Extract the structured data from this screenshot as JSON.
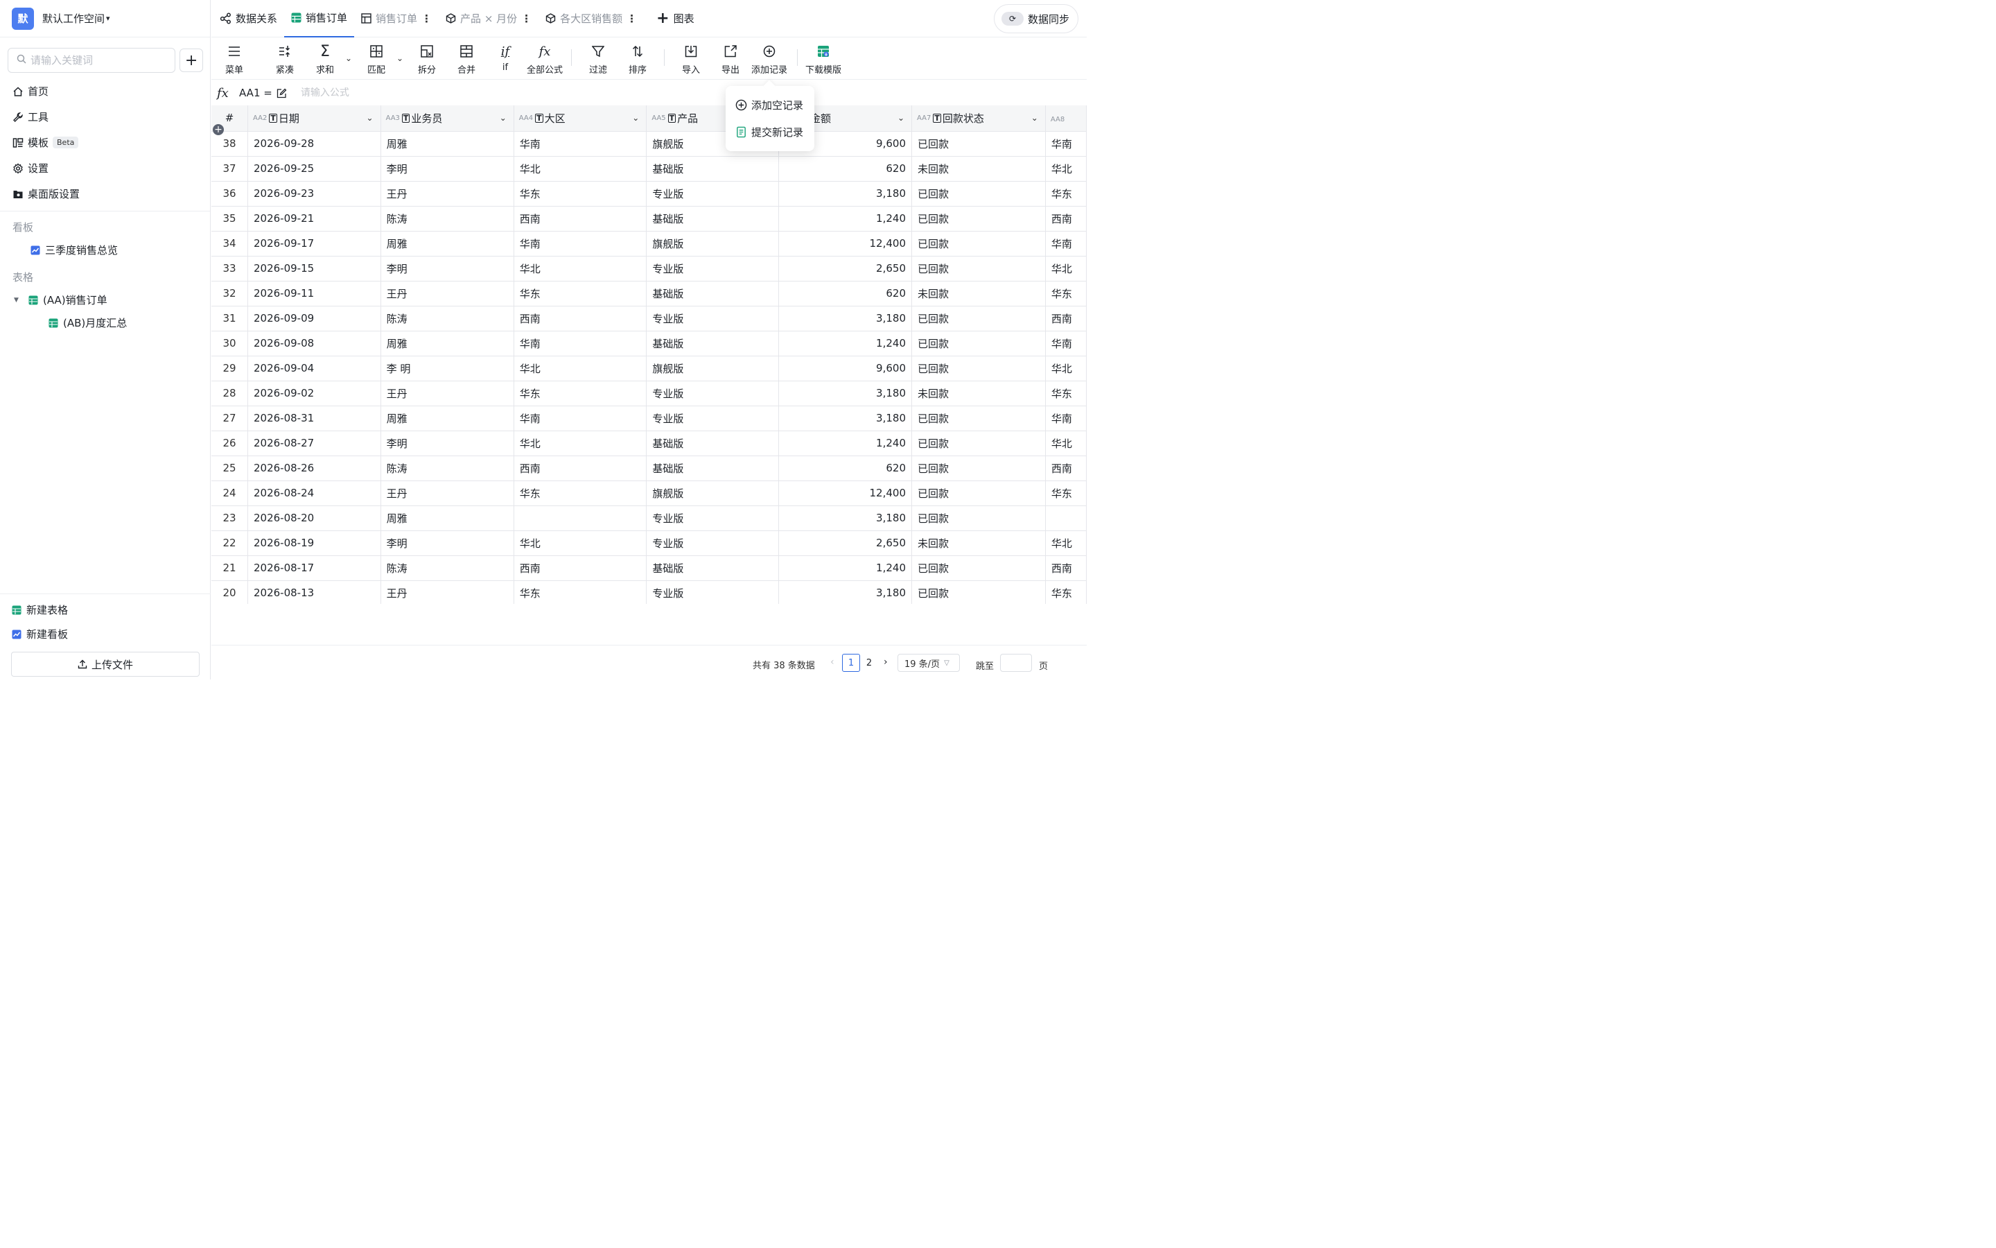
{
  "workspace": {
    "logo_char": "默",
    "name": "默认工作空间"
  },
  "sidebar": {
    "search_placeholder": "请输入关键词",
    "nav": [
      {
        "label": "首页",
        "icon": "home-icon"
      },
      {
        "label": "工具",
        "icon": "wrench-icon"
      },
      {
        "label": "模板",
        "icon": "template-icon",
        "badge": "Beta"
      },
      {
        "label": "设置",
        "icon": "gear-icon"
      },
      {
        "label": "桌面版设置",
        "icon": "desktop-settings-icon"
      }
    ],
    "section_dashboards": "看板",
    "dashboards": [
      {
        "label": "三季度销售总览"
      }
    ],
    "section_tables": "表格",
    "tables": [
      {
        "label": "(AA)销售订单"
      },
      {
        "label": "(AB)月度汇总"
      }
    ],
    "bottom": {
      "new_table": "新建表格",
      "new_dashboard": "新建看板",
      "upload": "上传文件"
    }
  },
  "tabs": [
    {
      "label": "数据关系",
      "icon": "relation-icon"
    },
    {
      "label": "销售订单",
      "icon": "table-icon",
      "active": true
    },
    {
      "label": "销售订单",
      "icon": "grid-icon"
    },
    {
      "label": "产品 × 月份",
      "icon": "cube-icon"
    },
    {
      "label": "各大区销售额",
      "icon": "cube-icon"
    },
    {
      "label": "图表",
      "icon": "plus-icon"
    }
  ],
  "sync_label": "数据同步",
  "toolbar": {
    "menu": "菜单",
    "compact": "紧凑",
    "sum": "求和",
    "match": "匹配",
    "split": "拆分",
    "merge": "合并",
    "if": "if",
    "all_formulas": "全部公式",
    "filter": "过滤",
    "sort": "排序",
    "import": "导入",
    "export": "导出",
    "add_record": "添加记录",
    "download_template": "下载模版"
  },
  "formula_bar": {
    "cell_ref": "AA1 =",
    "placeholder": "请输入公式"
  },
  "add_menu": {
    "add_empty": "添加空记录",
    "submit_new": "提交新记录"
  },
  "table": {
    "columns": [
      {
        "code": "",
        "name": "#"
      },
      {
        "code": "AA2",
        "name": "日期",
        "type": "T"
      },
      {
        "code": "AA3",
        "name": "业务员",
        "type": "T"
      },
      {
        "code": "AA4",
        "name": "大区",
        "type": "T"
      },
      {
        "code": "AA5",
        "name": "产品",
        "type": "T"
      },
      {
        "code": "",
        "name": "#金额"
      },
      {
        "code": "AA7",
        "name": "回款状态",
        "type": "T"
      },
      {
        "code": "AA8",
        "name": ""
      }
    ],
    "rows": [
      [
        "38",
        "2026-09-28",
        "周雅",
        "华南",
        "旗舰版",
        "9,600",
        "已回款",
        "华南"
      ],
      [
        "37",
        "2026-09-25",
        "李明",
        "华北",
        "基础版",
        "620",
        "未回款",
        "华北"
      ],
      [
        "36",
        "2026-09-23",
        "王丹",
        "华东",
        "专业版",
        "3,180",
        "已回款",
        "华东"
      ],
      [
        "35",
        "2026-09-21",
        "陈涛",
        "西南",
        "基础版",
        "1,240",
        "已回款",
        "西南"
      ],
      [
        "34",
        "2026-09-17",
        "周雅",
        "华南",
        "旗舰版",
        "12,400",
        "已回款",
        "华南"
      ],
      [
        "33",
        "2026-09-15",
        "李明",
        "华北",
        "专业版",
        "2,650",
        "已回款",
        "华北"
      ],
      [
        "32",
        "2026-09-11",
        "王丹",
        "华东",
        "基础版",
        "620",
        "未回款",
        "华东"
      ],
      [
        "31",
        "2026-09-09",
        "陈涛",
        "西南",
        "专业版",
        "3,180",
        "已回款",
        "西南"
      ],
      [
        "30",
        "2026-09-08",
        "周雅",
        "华南",
        "基础版",
        "1,240",
        "已回款",
        "华南"
      ],
      [
        "29",
        "2026-09-04",
        "李 明",
        "华北",
        "旗舰版",
        "9,600",
        "已回款",
        "华北"
      ],
      [
        "28",
        "2026-09-02",
        "王丹",
        "华东",
        "专业版",
        "3,180",
        "未回款",
        "华东"
      ],
      [
        "27",
        "2026-08-31",
        "周雅",
        "华南",
        "专业版",
        "3,180",
        "已回款",
        "华南"
      ],
      [
        "26",
        "2026-08-27",
        "李明",
        "华北",
        "基础版",
        "1,240",
        "已回款",
        "华北"
      ],
      [
        "25",
        "2026-08-26",
        "陈涛",
        "西南",
        "基础版",
        "620",
        "已回款",
        "西南"
      ],
      [
        "24",
        "2026-08-24",
        "王丹",
        "华东",
        "旗舰版",
        "12,400",
        "已回款",
        "华东"
      ],
      [
        "23",
        "2026-08-20",
        "周雅",
        "",
        "专业版",
        "3,180",
        "已回款",
        ""
      ],
      [
        "22",
        "2026-08-19",
        "李明",
        "华北",
        "专业版",
        "2,650",
        "未回款",
        "华北"
      ],
      [
        "21",
        "2026-08-17",
        "陈涛",
        "西南",
        "基础版",
        "1,240",
        "已回款",
        "西南"
      ],
      [
        "20",
        "2026-08-13",
        "王丹",
        "华东",
        "专业版",
        "3,180",
        "已回款",
        "华东"
      ]
    ]
  },
  "pagination": {
    "total": "共有 38 条数据",
    "page1": "1",
    "page2": "2",
    "page_size": "19 条/页",
    "jump": "跳至",
    "unit": "页"
  },
  "colors": {
    "accent": "#2f6ae0",
    "logo": "#4c7df0",
    "table_icon": "#1aa37a",
    "chart_icon": "#3f6fe8"
  }
}
